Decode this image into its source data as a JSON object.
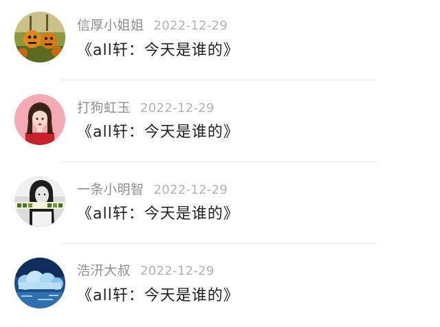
{
  "comments": [
    {
      "username": "信厚小姐姐",
      "date": "2022-12-29",
      "text": "《all轩：今天是谁的》",
      "avatar": "pumpkin-lanterns-avatar"
    },
    {
      "username": "打狗虹玉",
      "date": "2022-12-29",
      "text": "《all轩：今天是谁的》",
      "avatar": "cartoon-girl-avatar"
    },
    {
      "username": "一条小明智",
      "date": "2022-12-29",
      "text": "《all轩：今天是谁的》",
      "avatar": "bw-girl-photo-avatar"
    },
    {
      "username": "浩汧大叔",
      "date": "2022-12-29",
      "text": "《all轩：今天是谁的》",
      "avatar": "blue-sky-clouds-avatar"
    }
  ],
  "colors": {
    "username": "#8e8e8e",
    "date": "#b3b3b3",
    "text": "#1f1f1f",
    "divider": "#ededed"
  }
}
